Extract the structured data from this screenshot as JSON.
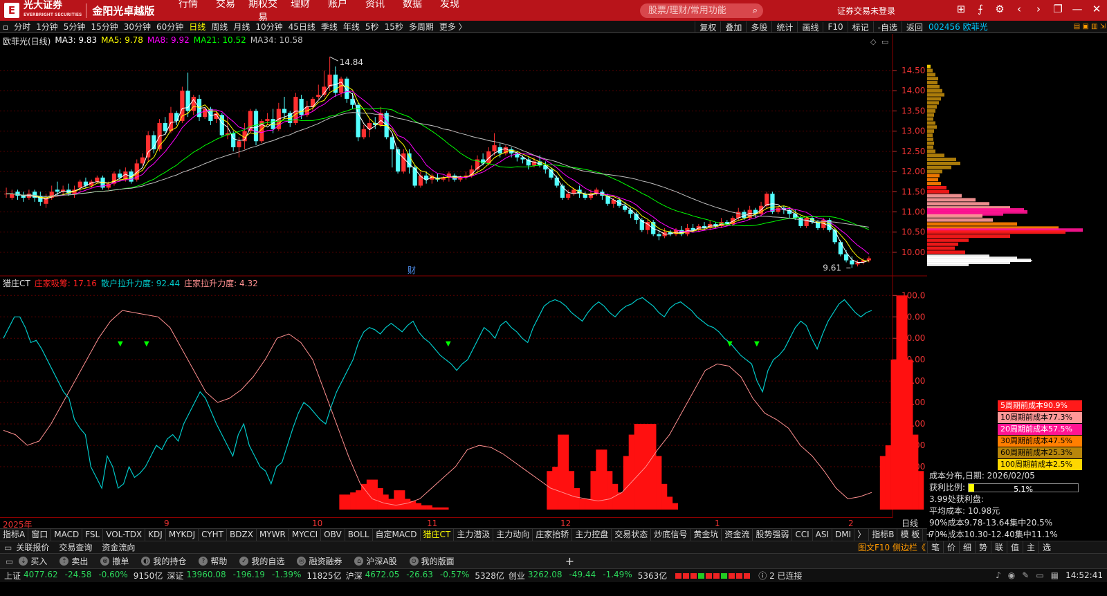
{
  "topbar": {
    "logo_mark": "E",
    "broker_name": "光大证券",
    "broker_name_en": "EVERBRIGHT SECURITIES",
    "slogan": "金阳光卓越版",
    "nav": [
      "行情",
      "交易",
      "期权交易",
      "理财",
      "账户",
      "资讯",
      "数据",
      "发现"
    ],
    "search_placeholder": "股票/理财/常用功能",
    "login_status": "证券交易未登录"
  },
  "periodbar": {
    "items": [
      "分时",
      "1分钟",
      "5分钟",
      "15分钟",
      "30分钟",
      "60分钟",
      "日线",
      "周线",
      "月线",
      "10分钟",
      "45日线",
      "季线",
      "年线",
      "5秒",
      "15秒",
      "多周期",
      "更多 〉"
    ],
    "active": "日线",
    "tools": [
      "复权",
      "叠加",
      "多股",
      "统计",
      "画线",
      "F10",
      "标记",
      "-自选",
      "返回"
    ]
  },
  "stock": {
    "code": "002456",
    "name": "欧菲光",
    "title": "002456 欧菲光"
  },
  "main_legend": {
    "name": "欧菲光(日线)",
    "ma3": "MA3: 9.83",
    "ma5": "MA5: 9.78",
    "ma8": "MA8: 9.92",
    "ma21": "MA21: 10.52",
    "ma34": "MA34: 10.58",
    "colors": {
      "ma3": "#ffffff",
      "ma5": "#ffff00",
      "ma8": "#ff00ff",
      "ma21": "#00ff00",
      "ma34": "#c0c0c0"
    }
  },
  "chart_data": {
    "type": "candlestick",
    "price_axis": {
      "labels": [
        "14.50",
        "14.00",
        "13.50",
        "13.00",
        "12.50",
        "12.00",
        "11.50",
        "11.00",
        "10.50",
        "10.00"
      ],
      "range": [
        9.45,
        15.1
      ]
    },
    "annotations": {
      "high": "14.84",
      "low": "9.61",
      "finance_marker": "财"
    },
    "date_axis": [
      "2025年",
      "9",
      "10",
      "11",
      "12",
      "1",
      "2"
    ],
    "period_label": "日线",
    "candles": [
      [
        11.45,
        11.45,
        11.6,
        11.35
      ],
      [
        11.35,
        11.45,
        11.55,
        11.3
      ],
      [
        11.5,
        11.4,
        11.55,
        11.3
      ],
      [
        11.4,
        11.35,
        11.5,
        11.25
      ],
      [
        11.35,
        11.45,
        11.55,
        11.3
      ],
      [
        11.5,
        11.35,
        11.55,
        11.25
      ],
      [
        11.4,
        11.25,
        11.5,
        11.15
      ],
      [
        11.2,
        11.35,
        11.45,
        11.1
      ],
      [
        11.35,
        11.5,
        11.65,
        11.3
      ],
      [
        11.55,
        11.5,
        11.75,
        11.4
      ],
      [
        11.5,
        11.55,
        11.65,
        11.4
      ],
      [
        11.55,
        11.45,
        11.7,
        11.4
      ],
      [
        11.45,
        11.55,
        11.65,
        11.35
      ],
      [
        11.6,
        11.75,
        11.8,
        11.5
      ],
      [
        11.75,
        11.65,
        11.85,
        11.6
      ],
      [
        11.65,
        11.75,
        11.8,
        11.6
      ],
      [
        11.75,
        11.85,
        11.9,
        11.7
      ],
      [
        11.85,
        11.6,
        11.9,
        11.55
      ],
      [
        11.6,
        11.7,
        11.75,
        11.55
      ],
      [
        11.7,
        11.95,
        12.0,
        11.65
      ],
      [
        11.95,
        11.85,
        12.05,
        11.75
      ],
      [
        11.8,
        12.0,
        12.1,
        11.75
      ],
      [
        12.0,
        11.75,
        12.05,
        11.7
      ],
      [
        11.8,
        12.2,
        12.3,
        11.75
      ],
      [
        12.2,
        12.35,
        12.45,
        12.15
      ],
      [
        12.35,
        12.9,
        13.0,
        12.25
      ],
      [
        12.9,
        12.55,
        13.0,
        12.45
      ],
      [
        12.55,
        13.2,
        13.3,
        12.5
      ],
      [
        13.2,
        13.0,
        13.35,
        12.95
      ],
      [
        13.0,
        13.45,
        13.6,
        12.95
      ],
      [
        13.45,
        13.25,
        13.5,
        13.15
      ],
      [
        13.25,
        14.0,
        14.1,
        13.2
      ],
      [
        14.0,
        13.5,
        14.45,
        13.35
      ],
      [
        13.5,
        13.85,
        13.9,
        13.4
      ],
      [
        13.8,
        13.35,
        13.9,
        13.25
      ],
      [
        13.35,
        13.55,
        13.6,
        13.3
      ],
      [
        13.55,
        13.25,
        13.6,
        13.15
      ],
      [
        13.3,
        13.45,
        13.5,
        13.2
      ],
      [
        13.4,
        12.9,
        13.45,
        12.85
      ],
      [
        12.9,
        12.95,
        13.35,
        12.8
      ],
      [
        12.95,
        12.6,
        13.0,
        12.5
      ],
      [
        12.6,
        12.75,
        12.85,
        12.35
      ],
      [
        12.75,
        13.0,
        13.2,
        12.55
      ],
      [
        13.0,
        13.5,
        13.55,
        12.95
      ],
      [
        13.5,
        12.75,
        13.55,
        12.65
      ],
      [
        12.75,
        13.25,
        13.3,
        12.7
      ],
      [
        13.25,
        13.3,
        13.45,
        13.15
      ],
      [
        13.3,
        13.05,
        13.55,
        12.95
      ],
      [
        13.05,
        13.55,
        13.7,
        13.0
      ],
      [
        13.55,
        13.45,
        13.85,
        13.3
      ],
      [
        13.45,
        13.2,
        13.5,
        13.1
      ],
      [
        13.2,
        13.85,
        13.95,
        13.15
      ],
      [
        13.8,
        13.4,
        13.9,
        13.3
      ],
      [
        13.4,
        13.6,
        13.75,
        13.35
      ],
      [
        13.6,
        13.8,
        13.85,
        13.5
      ],
      [
        13.85,
        13.9,
        14.15,
        13.8
      ],
      [
        13.9,
        14.1,
        14.5,
        13.85
      ],
      [
        14.1,
        14.4,
        14.84,
        14.0
      ],
      [
        14.4,
        13.95,
        14.6,
        13.85
      ],
      [
        13.95,
        14.3,
        14.35,
        13.85
      ],
      [
        14.3,
        13.8,
        14.35,
        13.7
      ],
      [
        13.8,
        13.65,
        13.95,
        13.55
      ],
      [
        13.65,
        12.85,
        13.7,
        12.75
      ],
      [
        12.85,
        13.05,
        13.15,
        12.8
      ],
      [
        13.05,
        13.2,
        13.3,
        12.85
      ],
      [
        13.2,
        13.15,
        13.35,
        13.05
      ],
      [
        13.15,
        13.45,
        13.6,
        13.1
      ],
      [
        13.45,
        12.85,
        13.5,
        12.8
      ],
      [
        12.85,
        12.55,
        12.9,
        12.1
      ],
      [
        12.55,
        12.0,
        12.6,
        11.95
      ],
      [
        12.0,
        12.45,
        12.55,
        11.95
      ],
      [
        12.45,
        12.1,
        12.55,
        11.95
      ],
      [
        12.1,
        11.65,
        12.15,
        11.6
      ],
      [
        11.65,
        11.9,
        12.0,
        11.6
      ],
      [
        11.9,
        11.8,
        12.0,
        11.7
      ],
      [
        11.8,
        11.9,
        11.95,
        11.7
      ],
      [
        11.85,
        11.8,
        11.95,
        11.75
      ],
      [
        11.8,
        11.85,
        11.9,
        11.75
      ],
      [
        11.85,
        11.95,
        12.0,
        11.75
      ],
      [
        11.9,
        11.8,
        11.95,
        11.75
      ],
      [
        11.8,
        11.85,
        11.9,
        11.75
      ],
      [
        11.85,
        11.9,
        12.0,
        11.8
      ],
      [
        11.9,
        12.05,
        12.15,
        11.85
      ],
      [
        12.05,
        12.3,
        12.4,
        12.0
      ],
      [
        12.3,
        12.2,
        12.45,
        12.15
      ],
      [
        12.2,
        12.5,
        12.6,
        12.15
      ],
      [
        12.5,
        12.65,
        12.95,
        12.4
      ],
      [
        12.6,
        12.45,
        12.7,
        12.35
      ],
      [
        12.45,
        12.6,
        12.65,
        12.4
      ],
      [
        12.55,
        12.45,
        12.6,
        12.35
      ],
      [
        12.45,
        12.35,
        12.5,
        12.25
      ],
      [
        12.35,
        12.3,
        12.4,
        12.2
      ],
      [
        12.3,
        12.15,
        12.35,
        12.05
      ],
      [
        12.15,
        12.25,
        12.35,
        12.1
      ],
      [
        12.25,
        12.15,
        12.4,
        12.1
      ],
      [
        12.15,
        12.05,
        12.25,
        11.95
      ],
      [
        12.05,
        11.85,
        12.1,
        11.8
      ],
      [
        11.85,
        11.65,
        11.9,
        11.6
      ],
      [
        11.65,
        11.35,
        11.7,
        11.3
      ],
      [
        11.35,
        11.45,
        11.55,
        11.3
      ],
      [
        11.45,
        11.55,
        11.6,
        11.4
      ],
      [
        11.55,
        11.45,
        11.65,
        11.35
      ],
      [
        11.45,
        11.35,
        11.5,
        11.3
      ],
      [
        11.35,
        11.45,
        11.55,
        11.3
      ],
      [
        11.45,
        11.55,
        11.6,
        11.4
      ],
      [
        11.5,
        11.4,
        11.55,
        11.3
      ],
      [
        11.4,
        11.2,
        11.45,
        11.15
      ],
      [
        11.2,
        11.3,
        11.35,
        11.1
      ],
      [
        11.3,
        11.15,
        11.35,
        11.1
      ],
      [
        11.15,
        11.05,
        11.25,
        11.0
      ],
      [
        11.05,
        10.95,
        11.1,
        10.85
      ],
      [
        10.95,
        10.8,
        11.0,
        10.7
      ],
      [
        10.8,
        10.55,
        10.85,
        10.5
      ],
      [
        10.55,
        10.75,
        10.8,
        10.45
      ],
      [
        10.75,
        10.45,
        10.8,
        10.4
      ],
      [
        10.45,
        10.4,
        10.55,
        10.3
      ],
      [
        10.4,
        10.5,
        10.6,
        10.35
      ],
      [
        10.5,
        10.45,
        10.55,
        10.4
      ],
      [
        10.45,
        10.55,
        10.6,
        10.4
      ],
      [
        10.55,
        10.45,
        10.65,
        10.4
      ],
      [
        10.45,
        10.6,
        10.7,
        10.4
      ],
      [
        10.6,
        10.55,
        10.7,
        10.5
      ],
      [
        10.55,
        10.65,
        10.7,
        10.5
      ],
      [
        10.65,
        10.6,
        10.75,
        10.55
      ],
      [
        10.6,
        10.7,
        10.8,
        10.55
      ],
      [
        10.7,
        10.65,
        10.75,
        10.6
      ],
      [
        10.65,
        10.75,
        10.85,
        10.6
      ],
      [
        10.75,
        10.7,
        10.8,
        10.65
      ],
      [
        10.7,
        10.85,
        10.9,
        10.65
      ],
      [
        10.85,
        11.0,
        11.1,
        10.8
      ],
      [
        11.0,
        10.85,
        11.05,
        10.8
      ],
      [
        10.85,
        11.05,
        11.15,
        10.8
      ],
      [
        11.05,
        10.95,
        11.1,
        10.85
      ],
      [
        10.95,
        11.15,
        11.25,
        10.9
      ],
      [
        11.15,
        11.45,
        11.5,
        11.1
      ],
      [
        11.45,
        11.0,
        11.5,
        10.95
      ],
      [
        11.0,
        11.1,
        11.15,
        10.95
      ],
      [
        11.1,
        11.05,
        11.15,
        10.95
      ],
      [
        11.05,
        10.95,
        11.1,
        10.85
      ],
      [
        10.95,
        10.85,
        11.05,
        10.8
      ],
      [
        10.85,
        10.65,
        10.9,
        10.6
      ],
      [
        10.65,
        10.85,
        10.9,
        10.6
      ],
      [
        10.85,
        10.75,
        10.9,
        10.7
      ],
      [
        10.75,
        10.6,
        10.8,
        10.55
      ],
      [
        10.6,
        10.8,
        10.85,
        10.55
      ],
      [
        10.8,
        10.55,
        10.85,
        10.5
      ],
      [
        10.55,
        10.25,
        10.6,
        10.2
      ],
      [
        10.25,
        9.95,
        10.3,
        9.9
      ],
      [
        9.95,
        9.8,
        10.05,
        9.75
      ],
      [
        9.8,
        9.7,
        9.9,
        9.61
      ],
      [
        9.7,
        9.75,
        9.8,
        9.65
      ],
      [
        9.75,
        9.8,
        9.85,
        9.7
      ],
      [
        9.8,
        9.85,
        9.9,
        9.75
      ]
    ],
    "indicator": {
      "name": "猎庄CT",
      "series": [
        {
          "name": "庄家吸筹",
          "value": "庄家吸筹: 17.16",
          "color": "#ff2020"
        },
        {
          "name": "散户拉升力度",
          "value": "散户拉升力度: 92.44",
          "color": "#00c8c8"
        },
        {
          "name": "庄家拉升力度",
          "value": "庄家拉升力度: 4.32",
          "color": "#ff9090"
        }
      ],
      "axis_labels": [
        "100.0",
        "90.00",
        "80.00",
        "70.00",
        "60.00",
        "50.00",
        "40.00",
        "30.00",
        "20.00"
      ],
      "range": [
        0,
        103
      ],
      "cyan": [
        80,
        85,
        90,
        90,
        85,
        78,
        79,
        75,
        70,
        65,
        60,
        55,
        52,
        42,
        38,
        35,
        20,
        15,
        10,
        25,
        20,
        10,
        12,
        20,
        15,
        17,
        20,
        25,
        30,
        28,
        33,
        35,
        32,
        40,
        45,
        50,
        55,
        52,
        46,
        40,
        35,
        30,
        25,
        35,
        40,
        30,
        25,
        20,
        18,
        12,
        20,
        22,
        30,
        38,
        45,
        50,
        48,
        45,
        42,
        40,
        48,
        55,
        60,
        65,
        70,
        78,
        83,
        85,
        84,
        82,
        85,
        87,
        85,
        83,
        86,
        88,
        83,
        80,
        78,
        75,
        72,
        70,
        68,
        65,
        68,
        70,
        75,
        80,
        85,
        83,
        80,
        86,
        88,
        85,
        83,
        80,
        78,
        85,
        90,
        95,
        97,
        98,
        97,
        95,
        92,
        90,
        88,
        92,
        95,
        97,
        95,
        92,
        90,
        93,
        95,
        96,
        98,
        99,
        97,
        95,
        92,
        90,
        94,
        96,
        97,
        95,
        93,
        90,
        88,
        86,
        85,
        83,
        80,
        78,
        75,
        72,
        70,
        68,
        60,
        55,
        65,
        70,
        72,
        75,
        80,
        85,
        88,
        86,
        80,
        75,
        82,
        88,
        92,
        96,
        98,
        95,
        92,
        90,
        92,
        93
      ]
    }
  },
  "cost_distribution": {
    "legend": [
      {
        "text": "5周期前成本90.9%",
        "color": "#ff1a1a",
        "fg": "#ffffff"
      },
      {
        "text": "10周期前成本77.3%",
        "color": "#ff9999",
        "fg": "#000000"
      },
      {
        "text": "20周期前成本57.5%",
        "color": "#ff1493",
        "fg": "#ffffff"
      },
      {
        "text": "30周期前成本47.5%",
        "color": "#ff7f00",
        "fg": "#000000"
      },
      {
        "text": "60周期前成本25.3%",
        "color": "#b8860b",
        "fg": "#000000"
      },
      {
        "text": "100周期前成本2.5%",
        "color": "#ffd700",
        "fg": "#000000"
      }
    ],
    "date_line": "成本分布,日期: 2026/02/05",
    "profit_ratio_label": "获利比例:",
    "profit_ratio_value": "5.1%",
    "profit_ratio": 0.051,
    "profit_at": "3.99处获利盘:",
    "avg_cost": "平均成本: 10.98元",
    "cost90": "90%成本9.78-13.64集中20.5%",
    "cost70": "70%成本10.30-12.40集中11.1%"
  },
  "indicator_tabs": {
    "items": [
      "指标A",
      "窗口",
      "MACD",
      "FSL",
      "VOL-TDX",
      "KDJ",
      "MYKDJ",
      "CYHT",
      "BDZX",
      "MYWR",
      "MYCCI",
      "OBV",
      "BOLL",
      "自定MACD",
      "猎庄CT",
      "主力潜汲",
      "主力动向",
      "庄家抬轿",
      "主力控盘",
      "交易状态",
      "炒底信号",
      "黄金坑",
      "资金流",
      "股势强弱",
      "CCI",
      "ASI",
      "DMI",
      "〉",
      "指标B",
      "模 板",
      "+",
      "−"
    ],
    "active": "猎庄CT"
  },
  "bottom": {
    "links": [
      "关联报价",
      "交易查询",
      "资金流向"
    ],
    "side_button": "图文F10 侧边栏《",
    "right_tabs": [
      "笔",
      "价",
      "细",
      "势",
      "联",
      "值",
      "主",
      "选"
    ],
    "actions": [
      "买入",
      "卖出",
      "撤单",
      "我的持仓",
      "帮助",
      "我的自选",
      "融资融券",
      "沪深A股",
      "我的版面"
    ],
    "add": "+",
    "indices": [
      {
        "name": "上证",
        "price": "4077.62",
        "chg": "-24.58",
        "pct": "-0.60%",
        "vol": "9150亿"
      },
      {
        "name": "深证",
        "price": "13960.08",
        "chg": "-196.19",
        "pct": "-1.39%",
        "vol": "11825亿"
      },
      {
        "name": "沪深",
        "price": "4672.05",
        "chg": "-26.63",
        "pct": "-0.57%",
        "vol": "5328亿"
      },
      {
        "name": "创业",
        "price": "3262.08",
        "chg": "-49.44",
        "pct": "-1.49%",
        "vol": "5363亿"
      }
    ],
    "conn_count": "2",
    "conn_status": "已连接",
    "time": "14:52:41"
  }
}
